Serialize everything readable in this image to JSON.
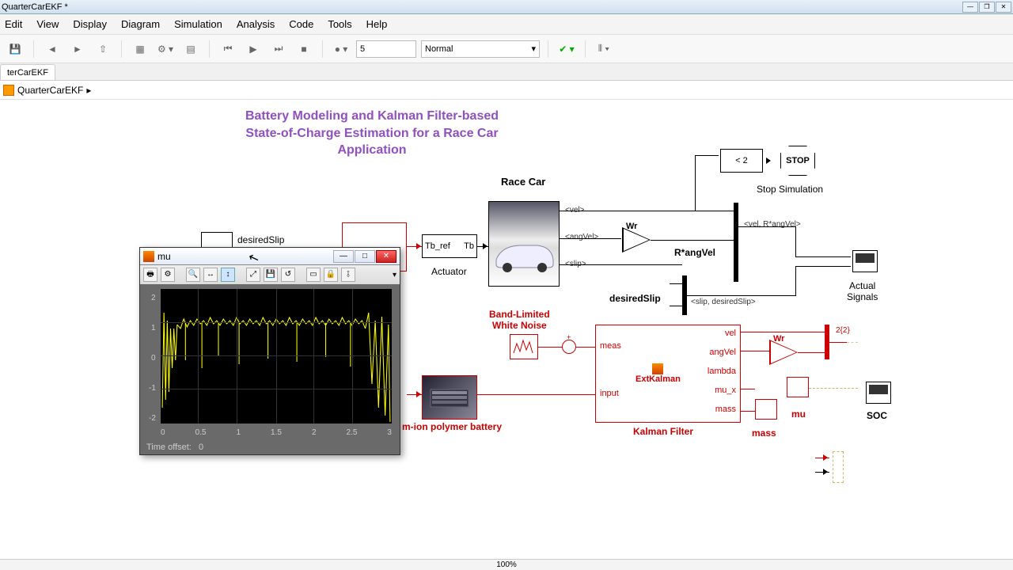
{
  "window": {
    "title": "QuarterCarEKF *"
  },
  "menu": {
    "edit": "Edit",
    "view": "View",
    "display": "Display",
    "diagram": "Diagram",
    "simulation": "Simulation",
    "analysis": "Analysis",
    "code": "Code",
    "tools": "Tools",
    "help": "Help"
  },
  "toolbar": {
    "stoptime": "5",
    "mode": "Normal"
  },
  "tabs": {
    "main": "terCarEKF"
  },
  "breadcrumb": {
    "root": "QuarterCarEKF"
  },
  "diagram": {
    "title_l1": "Battery Modeling and Kalman Filter-based",
    "title_l2": "State-of-Charge Estimation for a Race Car",
    "title_l3": "Application",
    "desiredSlip": "desiredSlip",
    "tb_ref": "Tb_ref",
    "tb": "Tb",
    "actuator": "Actuator",
    "racecar": "Race Car",
    "vel": "<vel>",
    "angVel": "<angVel>",
    "slip": "<slip>",
    "wr": "Wr",
    "wr2": "Wr",
    "rangvel": "R*angVel",
    "lt2": "< 2",
    "stop": "STOP",
    "stopsim": "Stop Simulation",
    "actualsignals_l1": "Actual",
    "actualsignals_l2": "Signals",
    "velRang": "<vel, R*angVel>",
    "desiredSlipPort": "desiredSlip",
    "slipDesired": "<slip, desiredSlip>",
    "bandlimited_l1": "Band-Limited",
    "bandlimited_l2": "White Noise",
    "battery": "m-ion polymer battery",
    "meas": "meas",
    "input": "input",
    "ekf_vel": "vel",
    "ekf_angVel": "angVel",
    "ekf_lambda": "lambda",
    "ekf_mu_x": "mu_x",
    "ekf_mass": "mass",
    "extkalman": "ExtKalman",
    "kalmanfilter": "Kalman Filter",
    "mu": "mu",
    "mass": "mass",
    "soc": "SOC",
    "port2": "2",
    "port22": "2{2}"
  },
  "scope": {
    "title": "mu",
    "timeoffset_label": "Time offset:",
    "timeoffset_value": "0",
    "yticks": [
      "2",
      "1",
      "0",
      "-1",
      "-2"
    ],
    "xticks": [
      "0",
      "0.5",
      "1",
      "1.5",
      "2",
      "2.5",
      "3"
    ]
  },
  "status": {
    "zoom": "100%"
  },
  "chart_data": {
    "type": "line",
    "title": "mu",
    "xlabel": "",
    "ylabel": "",
    "xlim": [
      0,
      3
    ],
    "ylim": [
      -2,
      2
    ],
    "series": [
      {
        "name": "mu",
        "x": [
          0,
          0.05,
          0.1,
          0.15,
          0.2,
          0.3,
          0.5,
          0.7,
          1.0,
          1.3,
          1.5,
          1.8,
          2.0,
          2.3,
          2.5,
          2.7,
          2.8,
          2.9,
          3.0
        ],
        "y": [
          -1.5,
          0.5,
          -1.0,
          0.8,
          0.2,
          1.0,
          0.9,
          1.1,
          0.95,
          1.05,
          0.9,
          1.0,
          1.1,
          0.9,
          1.15,
          0.8,
          1.2,
          -0.5,
          -1.8
        ],
        "note": "noisy yellow trace roughly centered around 1 between x≈0.2 and x≈2.8 with transient spikes at start and end"
      }
    ]
  }
}
